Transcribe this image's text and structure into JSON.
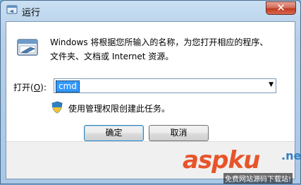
{
  "window": {
    "title": "运行",
    "close_symbol": "✕",
    "title_icon": "run-icon"
  },
  "dialog": {
    "description_line1": "Windows 将根据您所输入的名称，为您打开相应的程序、",
    "description_line2": "文件夹、文档或 Internet 资源。",
    "open_label_prefix": "打开(",
    "open_label_key": "O",
    "open_label_suffix": "):",
    "open_value": "cmd",
    "admin_note": "使用管理权限创建此任务。",
    "ok_label": "确定",
    "cancel_label": "取消"
  },
  "watermark": {
    "logo_a": "asp",
    "logo_b": "ku",
    "logo_net": ".net",
    "sub": "免费网站源码下载站!"
  },
  "colors": {
    "selection": "#3399ff",
    "close_button": "#c03b22",
    "accent": "#e8542a"
  }
}
